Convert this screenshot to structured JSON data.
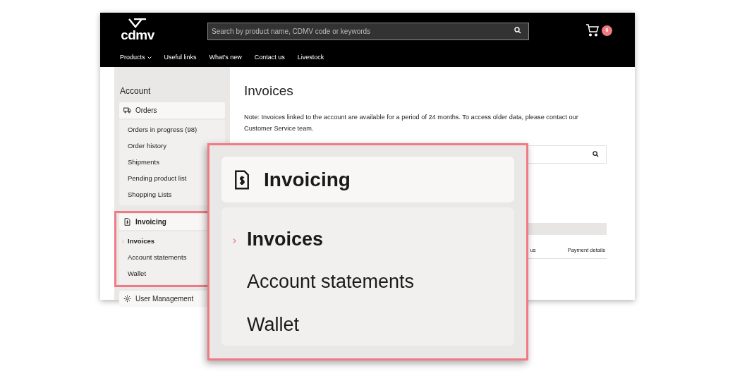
{
  "header": {
    "logo": "cdmv",
    "search": {
      "placeholder": "Search by product name, CDMV code or keywords"
    },
    "cart_count": "0",
    "nav": [
      {
        "label": "Products",
        "dropdown": true
      },
      {
        "label": "Useful links",
        "dropdown": false
      },
      {
        "label": "What's new",
        "dropdown": false
      },
      {
        "label": "Contact us",
        "dropdown": false
      },
      {
        "label": "Livestock",
        "dropdown": false
      }
    ]
  },
  "sidebar": {
    "title": "Account",
    "groups": [
      {
        "label": "Orders",
        "highlighted": false,
        "items": [
          {
            "label": "Orders in progress (98)",
            "selected": false
          },
          {
            "label": "Order history",
            "selected": false
          },
          {
            "label": "Shipments",
            "selected": false
          },
          {
            "label": "Pending product list",
            "selected": false
          },
          {
            "label": "Shopping Lists",
            "selected": false
          }
        ]
      },
      {
        "label": "Invoicing",
        "highlighted": true,
        "items": [
          {
            "label": "Invoices",
            "selected": true
          },
          {
            "label": "Account statements",
            "selected": false
          },
          {
            "label": "Wallet",
            "selected": false
          }
        ]
      },
      {
        "label": "User Management",
        "highlighted": false
      }
    ]
  },
  "main": {
    "title": "Invoices",
    "note": "Note: Invoices linked to the account are available for a period of 24 months. To access older data, please contact our Customer Service team.",
    "table": {
      "columns": [
        "us",
        "Payment details"
      ]
    }
  },
  "callout": {
    "label": "Invoicing",
    "items": [
      {
        "label": "Invoices",
        "selected": true
      },
      {
        "label": "Account statements",
        "selected": false
      },
      {
        "label": "Wallet",
        "selected": false
      }
    ]
  }
}
